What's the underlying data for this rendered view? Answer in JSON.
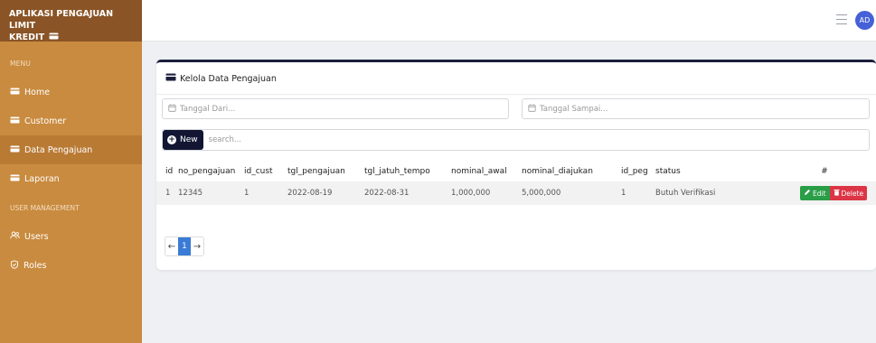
{
  "app": {
    "title_line1": "APLIKASI PENGAJUAN LIMIT",
    "title_line2": "KREDIT"
  },
  "sidebar": {
    "menu_heading": "MENU",
    "items": [
      {
        "label": "Home",
        "icon": "card-icon"
      },
      {
        "label": "Customer",
        "icon": "card-icon"
      },
      {
        "label": "Data Pengajuan",
        "icon": "card-icon",
        "active": true
      },
      {
        "label": "Laporan",
        "icon": "card-icon"
      }
    ],
    "management_heading": "USER MANAGEMENT",
    "management_items": [
      {
        "label": "Users",
        "icon": "users-icon"
      },
      {
        "label": "Roles",
        "icon": "shield-icon"
      }
    ]
  },
  "topbar": {
    "avatar_initials": "AD"
  },
  "card": {
    "title": "Kelola Data Pengajuan",
    "date_from_placeholder": "Tanggal Dari...",
    "date_to_placeholder": "Tanggal Sampai...",
    "new_button": "New",
    "search_placeholder": "search..."
  },
  "table": {
    "headers": [
      "id",
      "no_pengajuan",
      "id_cust",
      "tgl_pengajuan",
      "tgl_jatuh_tempo",
      "nominal_awal",
      "nominal_diajukan",
      "id_peg",
      "status",
      "#"
    ],
    "rows": [
      {
        "id": "1",
        "no_pengajuan": "12345",
        "id_cust": "1",
        "tgl_pengajuan": "2022-08-19",
        "tgl_jatuh_tempo": "2022-08-31",
        "nominal_awal": "1,000,000",
        "nominal_diajukan": "5,000,000",
        "id_peg": "1",
        "status": "Butuh Verifikasi",
        "edit_label": "Edit",
        "delete_label": "Delete"
      }
    ]
  },
  "pagination": {
    "prev": "←",
    "current": "1",
    "next": "→"
  },
  "colors": {
    "sidebar": "#c98b3f",
    "brand": "#8a5426",
    "accent": "#121633",
    "edit": "#2a9d47",
    "delete": "#dc3545",
    "page_active": "#3a7bd5"
  }
}
